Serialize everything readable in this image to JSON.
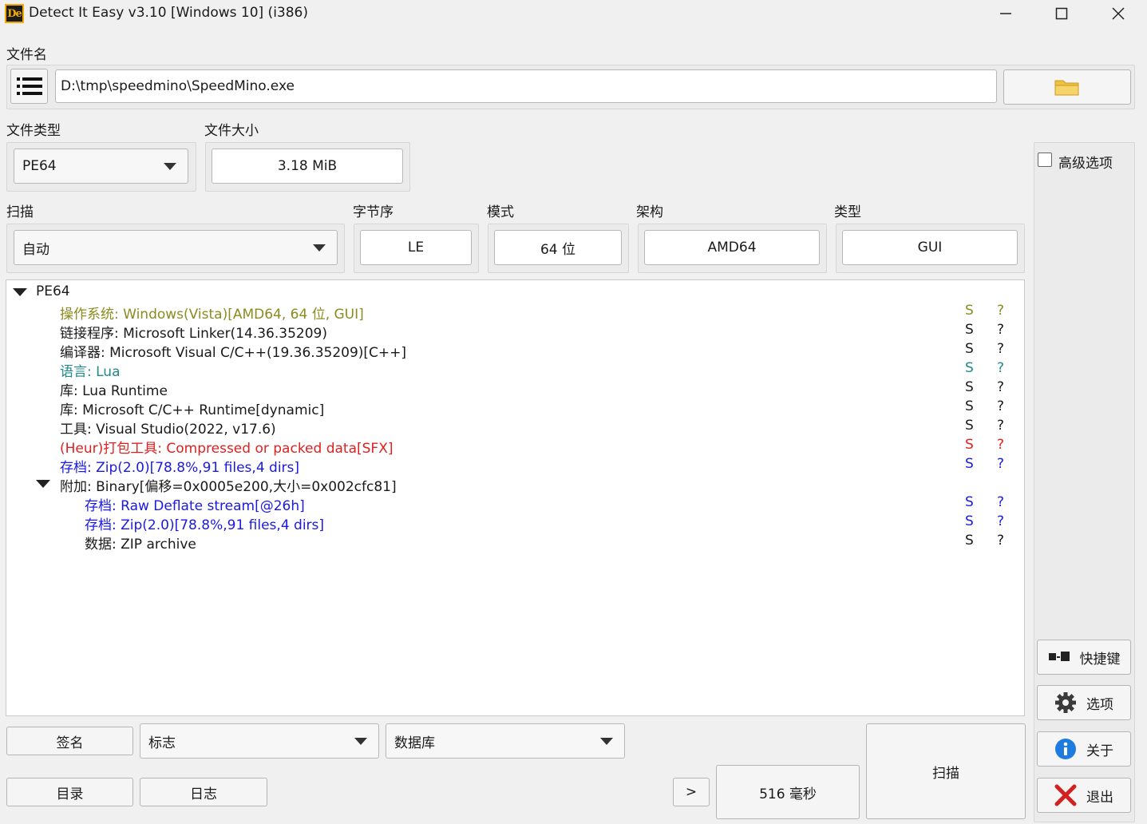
{
  "window": {
    "title": "Detect It Easy v3.10 [Windows 10] (i386)",
    "logo_text": "De"
  },
  "file": {
    "label": "文件名",
    "path": "D:\\tmp\\speedmino\\SpeedMino.exe"
  },
  "filetype": {
    "label": "文件类型",
    "value": "PE64"
  },
  "filesize": {
    "label": "文件大小",
    "value": "3.18 MiB"
  },
  "advanced": {
    "label": "高级选项",
    "checked": false
  },
  "scan": {
    "label": "扫描",
    "value": "自动"
  },
  "endian": {
    "label": "字节序",
    "value": "LE"
  },
  "mode": {
    "label": "模式",
    "value": "64 位"
  },
  "arch": {
    "label": "架构",
    "value": "AMD64"
  },
  "type": {
    "label": "类型",
    "value": "GUI"
  },
  "results": {
    "root": "PE64",
    "rows": [
      {
        "text": "操作系统: Windows(Vista)[AMD64, 64 位, GUI]",
        "s": "S",
        "q": "?",
        "color": "#8b8b1f"
      },
      {
        "text": "链接程序: Microsoft Linker(14.36.35209)",
        "s": "S",
        "q": "?",
        "color": "#1a1a1a"
      },
      {
        "text": "编译器: Microsoft Visual C/C++(19.36.35209)[C++]",
        "s": "S",
        "q": "?",
        "color": "#1a1a1a"
      },
      {
        "text": "语言: Lua",
        "s": "S",
        "q": "?",
        "color": "#1f8a8a"
      },
      {
        "text": "库: Lua Runtime",
        "s": "S",
        "q": "?",
        "color": "#1a1a1a"
      },
      {
        "text": "库: Microsoft C/C++ Runtime[dynamic]",
        "s": "S",
        "q": "?",
        "color": "#1a1a1a"
      },
      {
        "text": "工具: Visual Studio(2022, v17.6)",
        "s": "S",
        "q": "?",
        "color": "#1a1a1a"
      },
      {
        "text": "(Heur)打包工具: Compressed or packed data[SFX]",
        "s": "S",
        "q": "?",
        "color": "#e02020"
      },
      {
        "text": "存档: Zip(2.0)[78.8%,91 files,4 dirs]",
        "s": "S",
        "q": "?",
        "color": "#1a1ae0"
      }
    ],
    "overlay": "附加: Binary[偏移=0x0005e200,大小=0x002cfc81]",
    "overlay_rows": [
      {
        "text": "存档: Raw Deflate stream[@26h]",
        "s": "S",
        "q": "?",
        "color": "#1a1ae0"
      },
      {
        "text": "存档: Zip(2.0)[78.8%,91 files,4 dirs]",
        "s": "S",
        "q": "?",
        "color": "#1a1ae0"
      },
      {
        "text": "数据: ZIP archive",
        "s": "S",
        "q": "?",
        "color": "#1a1a1a"
      }
    ]
  },
  "bottom": {
    "signatures": "签名",
    "flags": "标志",
    "database": "数据库",
    "directory": "目录",
    "log": "日志",
    "more": ">",
    "time": "516 毫秒",
    "scan": "扫描"
  },
  "side": {
    "shortcuts": "快捷键",
    "options": "选项",
    "about": "关于",
    "exit": "退出"
  },
  "colors": {
    "os": "#8b8b1f",
    "language": "#1f8a8a",
    "heur": "#e02020",
    "archive": "#1a1ae0",
    "logo": "#f2a900"
  }
}
